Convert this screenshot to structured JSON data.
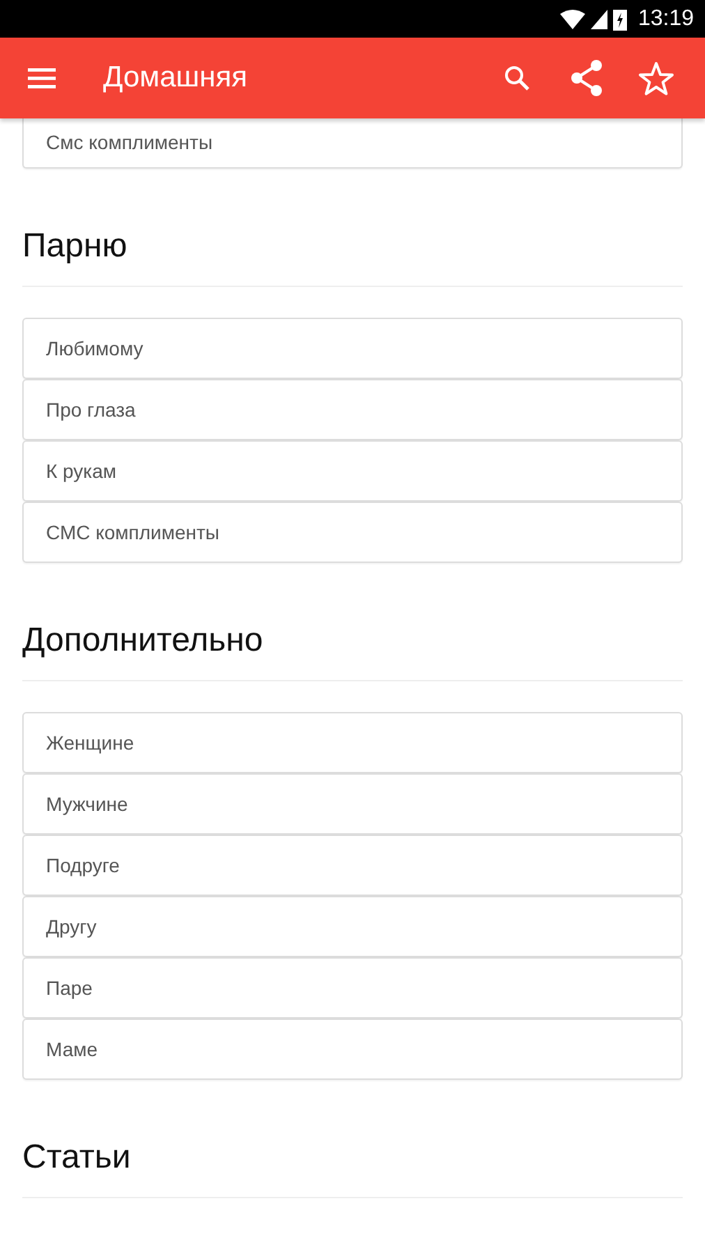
{
  "status_bar": {
    "time": "13:19"
  },
  "app_bar": {
    "title": "Домашняя"
  },
  "sections": [
    {
      "items": [
        "Смс комплименты"
      ]
    },
    {
      "title": "Парню",
      "items": [
        "Любимому",
        "Про глаза",
        "К рукам",
        "СМС комплименты"
      ]
    },
    {
      "title": "Дополнительно",
      "items": [
        "Женщине",
        "Мужчине",
        "Подруге",
        "Другу",
        "Паре",
        "Маме"
      ]
    },
    {
      "title": "Статьи"
    }
  ]
}
